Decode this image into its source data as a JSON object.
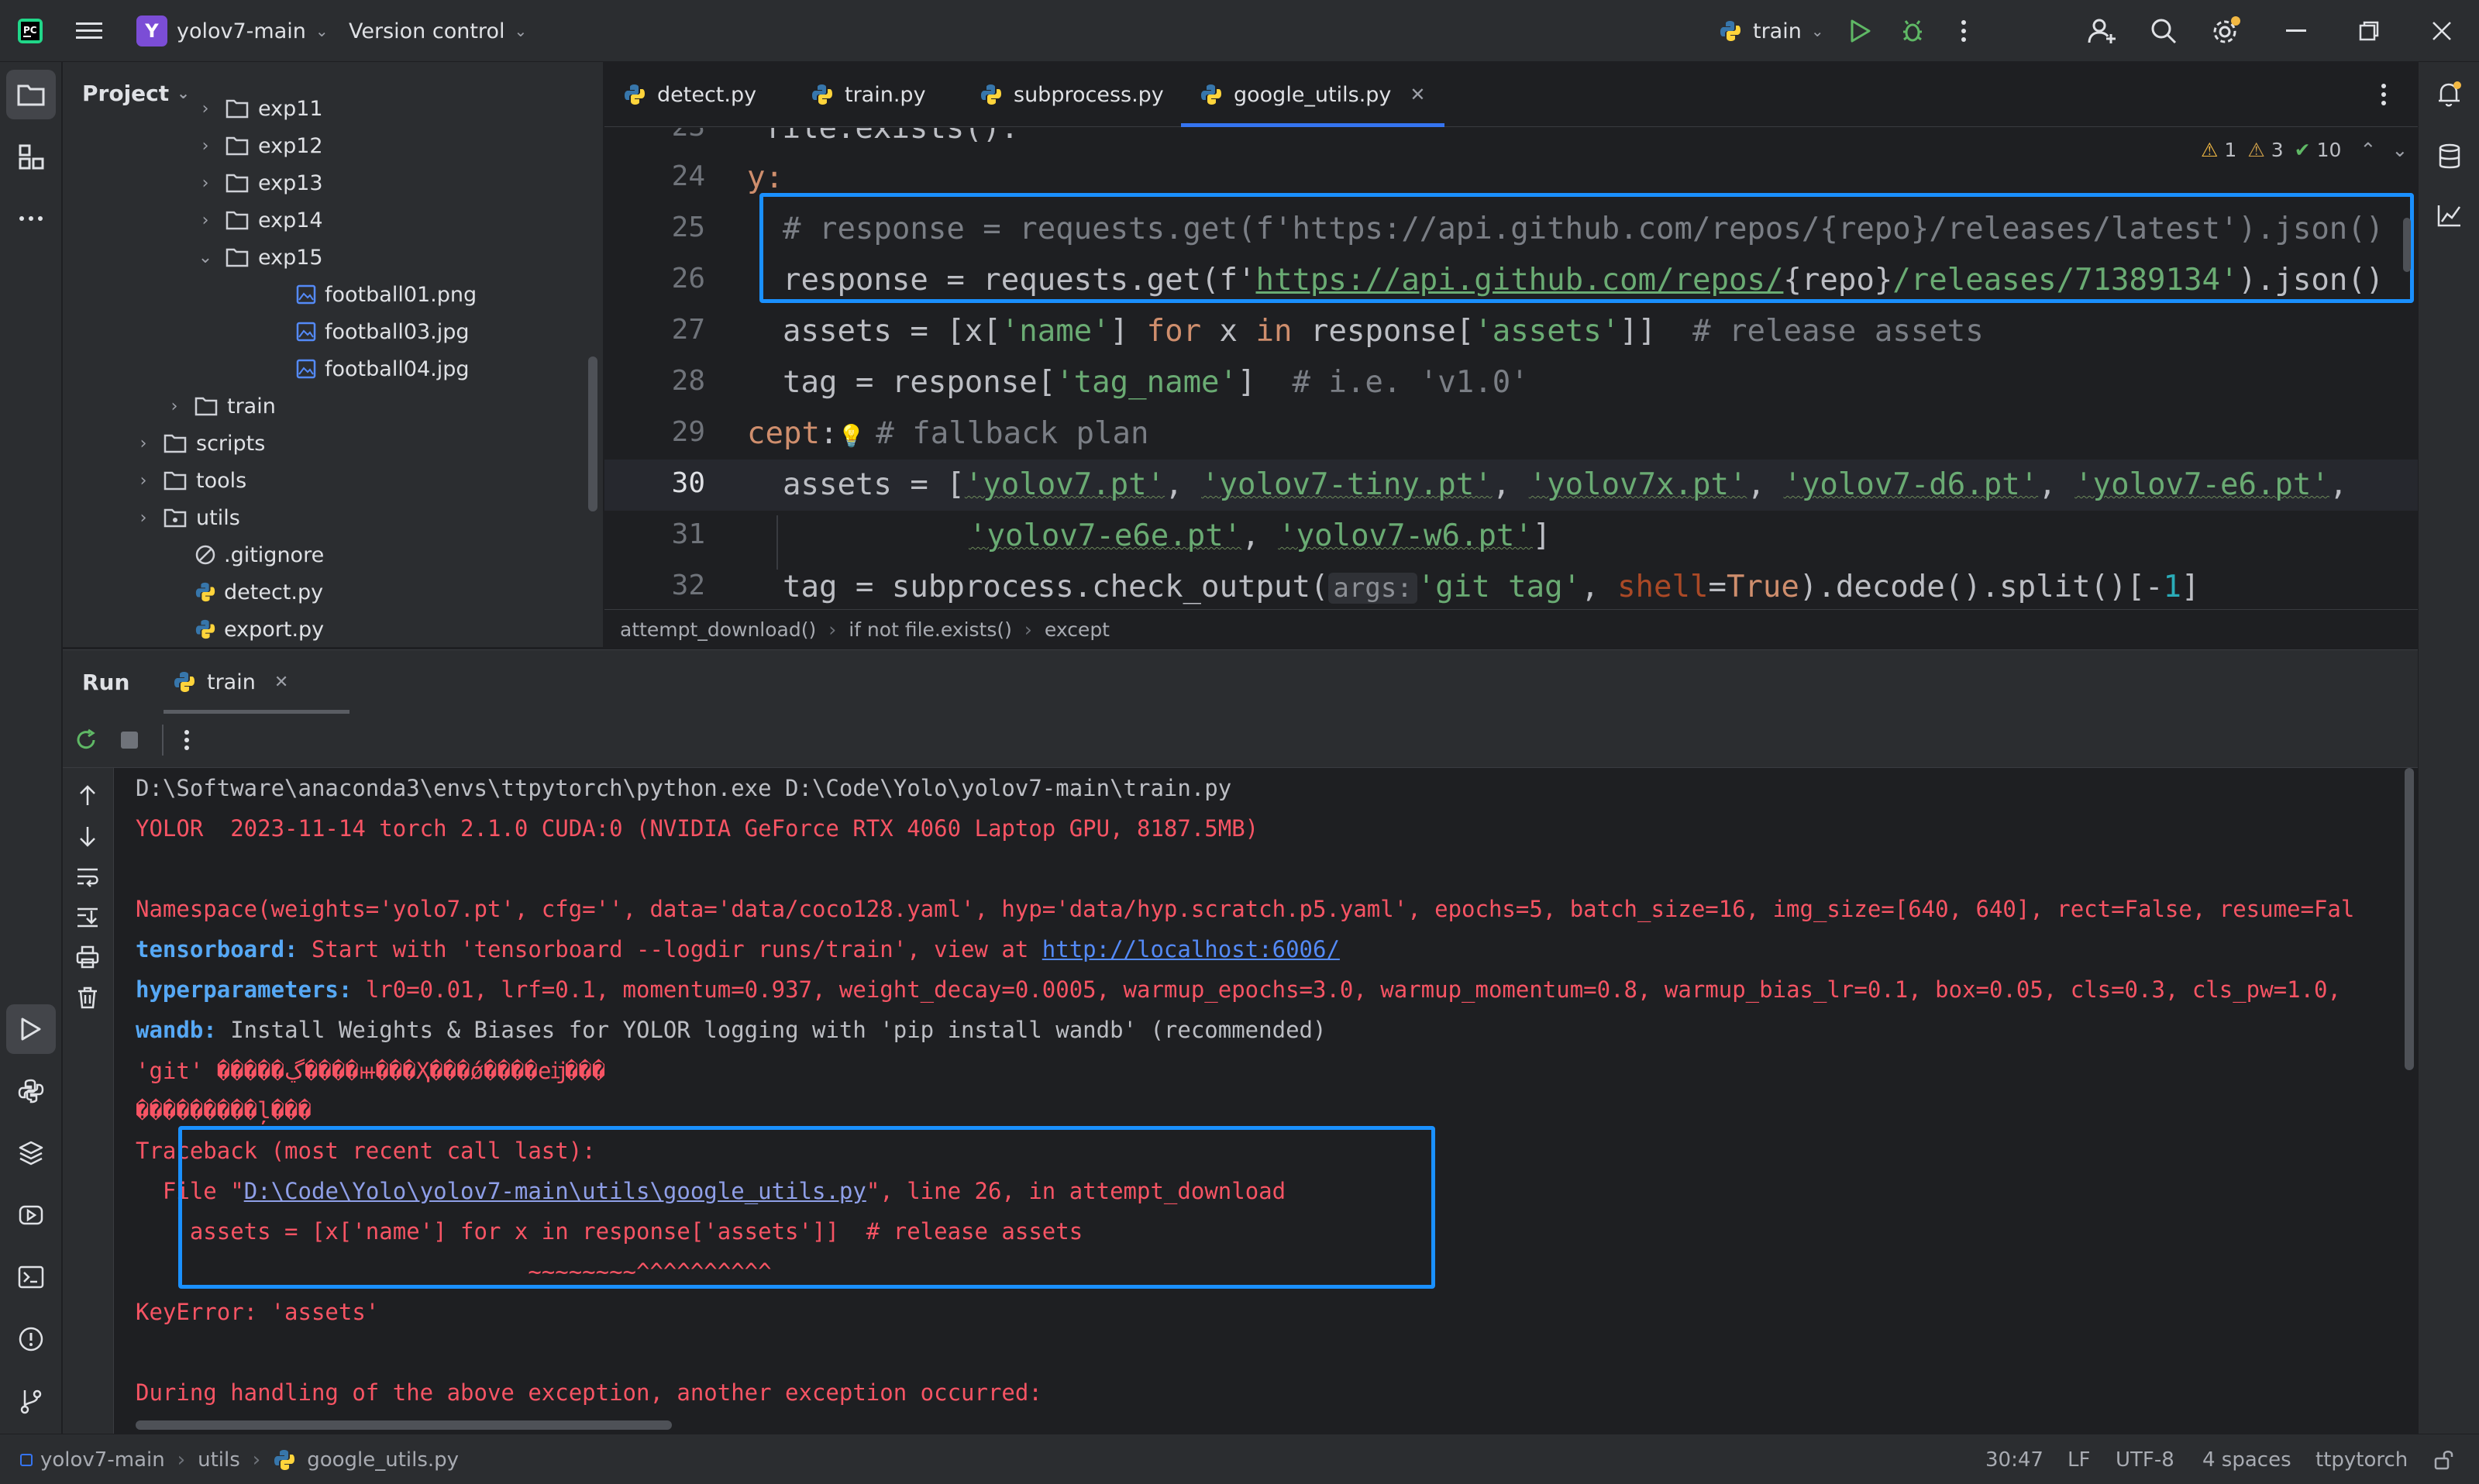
{
  "titlebar": {
    "project_initial": "Y",
    "project_name": "yolov7-main",
    "vcs_label": "Version control",
    "run_config": "train"
  },
  "project_panel": {
    "title": "Project",
    "items": [
      {
        "label": "exp11",
        "type": "folder",
        "expanded": false
      },
      {
        "label": "exp12",
        "type": "folder",
        "expanded": false
      },
      {
        "label": "exp13",
        "type": "folder",
        "expanded": false
      },
      {
        "label": "exp14",
        "type": "folder",
        "expanded": false
      },
      {
        "label": "exp15",
        "type": "folder",
        "expanded": true
      },
      {
        "label": "football01.png",
        "type": "image"
      },
      {
        "label": "football03.jpg",
        "type": "image"
      },
      {
        "label": "football04.jpg",
        "type": "image"
      },
      {
        "label": "train",
        "type": "folder",
        "expanded": false
      },
      {
        "label": "scripts",
        "type": "folder",
        "expanded": false
      },
      {
        "label": "tools",
        "type": "folder",
        "expanded": false
      },
      {
        "label": "utils",
        "type": "folder",
        "expanded": false
      },
      {
        "label": ".gitignore",
        "type": "ignore"
      },
      {
        "label": "detect.py",
        "type": "python"
      },
      {
        "label": "export.py",
        "type": "python"
      }
    ]
  },
  "tabs": [
    {
      "label": "detect.py",
      "active": false
    },
    {
      "label": "train.py",
      "active": false
    },
    {
      "label": "subprocess.py",
      "active": false
    },
    {
      "label": "google_utils.py",
      "active": true
    }
  ],
  "inspections": {
    "warnings": "1",
    "weak_warnings": "3",
    "ok": "10"
  },
  "editor": {
    "line_numbers": [
      "23",
      "24",
      "25",
      "26",
      "27",
      "28",
      "29",
      "30",
      "31",
      "32"
    ],
    "current_line": "30",
    "line_23": "file.exists():",
    "line_24": "y:",
    "line_25": "# response = requests.get(f'https://api.github.com/repos/{repo}/releases/latest').json()",
    "line_26_pre": "response = requests.get(f'",
    "line_26_url": "https://api.github.com/repos/",
    "line_26_mid": "{repo}",
    "line_26_post": "/releases/71389134'",
    "line_26_end": ").json()",
    "line_27_a": "assets = [x[",
    "line_27_s1": "'name'",
    "line_27_b": "] ",
    "line_27_for": "for",
    "line_27_c": " x ",
    "line_27_in": "in",
    "line_27_d": " response[",
    "line_27_s2": "'assets'",
    "line_27_e": "]]  ",
    "line_27_cmt": "# release assets",
    "line_28_a": "tag = response[",
    "line_28_s": "'tag_name'",
    "line_28_b": "]  ",
    "line_28_cmt": "# i.e. 'v1.0'",
    "line_29_kw": "cept",
    "line_29_colon": ":",
    "line_29_cmt": "# fallback plan",
    "line_30_a": "assets = [",
    "line_30_s1": "'yolov7.pt'",
    "line_30_s2": "'yolov7-tiny.pt'",
    "line_30_s3": "'yolov7x.pt'",
    "line_30_s4": "'yolov7-d6.pt'",
    "line_30_s5": "'yolov7-e6.pt'",
    "line_31_s1": "'yolov7-e6e.pt'",
    "line_31_s2": "'yolov7-w6.pt'",
    "line_31_end": "]",
    "line_32_a": "tag = subprocess.check_output(",
    "line_32_hint": "args:",
    "line_32_s": "'git tag'",
    "line_32_param": "shell",
    "line_32_eq": "=",
    "line_32_true": "True",
    "line_32_b": ").decode().split()[-",
    "line_32_num": "1",
    "line_32_c": "]"
  },
  "breadcrumb": [
    "attempt_download()",
    "if not file.exists()",
    "except"
  ],
  "run_panel": {
    "title": "Run",
    "tab_label": "train"
  },
  "console": {
    "l1": "D:\\Software\\anaconda3\\envs\\ttpytorch\\python.exe D:\\Code\\Yolo\\yolov7-main\\train.py",
    "l2": "YOLOR  2023-11-14 torch 2.1.0 CUDA:0 (NVIDIA GeForce RTX 4060 Laptop GPU, 8187.5MB)",
    "l3": "Namespace(weights='yolo7.pt', cfg='', data='data/coco128.yaml', hyp='data/hyp.scratch.p5.yaml', epochs=5, batch_size=16, img_size=[640, 640], rect=False, resume=Fal",
    "l4_key": "tensorboard:",
    "l4_a": " Start with 'tensorboard --logdir runs/train', view at ",
    "l4_link": "http://localhost:6006/",
    "l5_key": "hyperparameters:",
    "l5_a": " lr0=0.01, lrf=0.1, momentum=0.937, weight_decay=0.0005, warmup_epochs=3.0, warmup_momentum=0.8, warmup_bias_lr=0.1, box=0.05, cls=0.3, cls_pw=1.0,",
    "l6_key": "wandb:",
    "l6_a": " Install Weights & Biases for YOLOR logging with 'pip install wandb' (recommended)",
    "l7": "'git' �����ڲ����ⲿ���Ҳ���ǿ����еĳ���",
    "l8": "���������ļ���",
    "l9": "Traceback (most recent call last):",
    "l10_a": "  File \"",
    "l10_link": "D:\\Code\\Yolo\\yolov7-main\\utils\\google_utils.py",
    "l10_b": "\", line 26, in attempt_download",
    "l11": "    assets = [x['name'] for x in response['assets']]  # release assets",
    "l12": "                             ~~~~~~~~^^^^^^^^^^",
    "l13": "KeyError: 'assets'",
    "l14": "During handling of the above exception, another exception occurred:"
  },
  "statusbar": {
    "path": [
      "yolov7-main",
      "utils",
      "google_utils.py"
    ],
    "position": "30:47",
    "line_sep": "LF",
    "encoding": "UTF-8",
    "indent": "4 spaces",
    "interpreter": "ttpytorch"
  },
  "colors": {
    "accent": "#3574f0",
    "highlight_box": "#1a90ff",
    "error": "#f75464",
    "string": "#6aab73",
    "keyword": "#cf8e6d"
  }
}
